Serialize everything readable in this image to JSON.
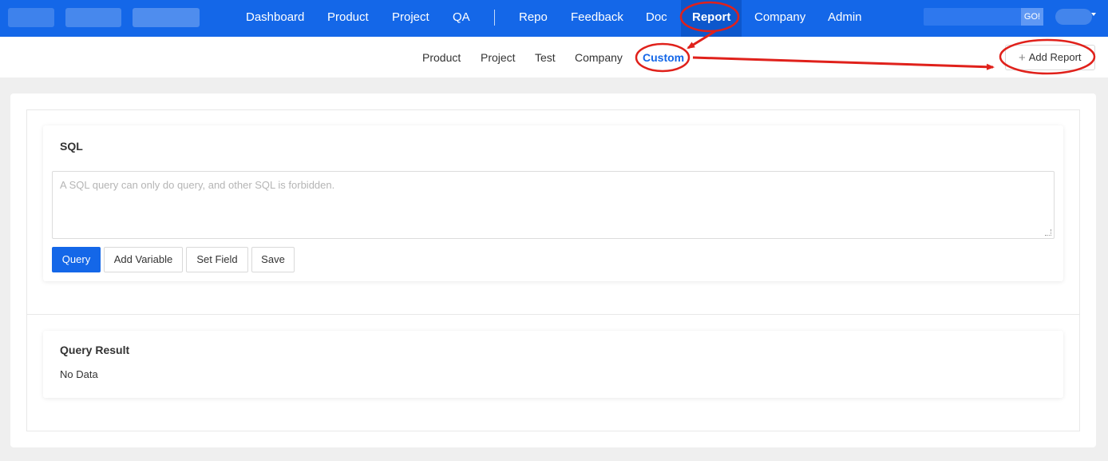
{
  "nav": {
    "items": [
      "Dashboard",
      "Product",
      "Project",
      "QA",
      "Repo",
      "Feedback",
      "Doc",
      "Report",
      "Company",
      "Admin"
    ],
    "active": "Report",
    "search_button": "GO!"
  },
  "subnav": {
    "items": [
      "Product",
      "Project",
      "Test",
      "Company",
      "Custom"
    ],
    "active": "Custom",
    "add_report_label": "Add Report"
  },
  "sql_card": {
    "title": "SQL",
    "placeholder": "A SQL query can only do query, and other SQL is forbidden.",
    "buttons": [
      "Query",
      "Add Variable",
      "Set Field",
      "Save"
    ]
  },
  "result_card": {
    "title": "Query Result",
    "empty_text": "No Data"
  },
  "colors": {
    "primary": "#1467e8",
    "annotation": "#e0211b"
  },
  "icons": [
    "plus-icon",
    "caret-down-icon",
    "resize-handle-icon"
  ]
}
